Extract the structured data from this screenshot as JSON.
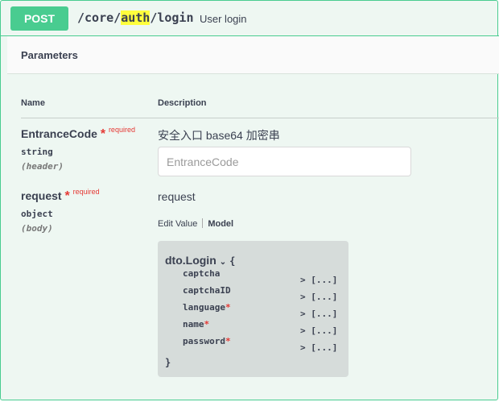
{
  "summary": {
    "method": "POST",
    "path_prefix": "/core/",
    "path_highlight": "auth",
    "path_suffix": "/login",
    "description": "User login"
  },
  "section": {
    "title": "Parameters"
  },
  "columns": {
    "name": "Name",
    "description": "Description"
  },
  "params": [
    {
      "name": "EntranceCode",
      "required_label": "required",
      "type": "string",
      "in": "(header)",
      "description": "安全入口 base64 加密串",
      "input_placeholder": "EntranceCode"
    },
    {
      "name": "request",
      "required_label": "required",
      "type": "object",
      "in": "(body)",
      "description": "request"
    }
  ],
  "body_tabs": {
    "edit_value": "Edit Value",
    "model": "Model"
  },
  "model": {
    "name": "dto.Login",
    "open_brace": "{",
    "close_brace": "}",
    "properties": [
      {
        "name": "captcha",
        "required": false,
        "value": "[...]"
      },
      {
        "name": "captchaID",
        "required": false,
        "value": "[...]"
      },
      {
        "name": "language",
        "required": true,
        "value": "[...]"
      },
      {
        "name": "name",
        "required": true,
        "value": "[...]"
      },
      {
        "name": "password",
        "required": true,
        "value": "[...]"
      }
    ]
  },
  "colors": {
    "post_green": "#49cc90",
    "required_red": "#e53935",
    "highlight_yellow": "#ffff3d"
  }
}
